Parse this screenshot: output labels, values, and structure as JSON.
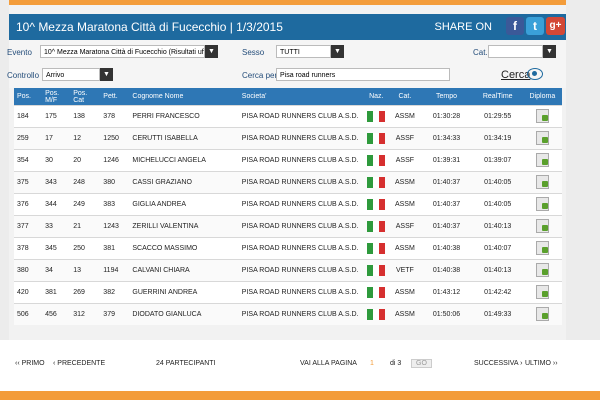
{
  "header": {
    "title": "10^ Mezza Maratona Città di Fucecchio  |  1/3/2015",
    "share_label": "SHARE ON",
    "social": [
      "f",
      "t",
      "g+"
    ]
  },
  "filters": {
    "evento_label": "Evento",
    "evento_value": "10^ Mezza Maratona Città di Fucecchio (Risultati ufficiali)",
    "sesso_label": "Sesso",
    "sesso_value": "TUTTI",
    "cat_label": "Cat.",
    "cat_value": "",
    "controllo_label": "Controllo",
    "controllo_value": "Arrivo",
    "cerca_per_label": "Cerca per",
    "cerca_per_value": "Pisa road runners",
    "cerca_button": "Cerca"
  },
  "table": {
    "headers": [
      "Pos.",
      "Pos. M/F",
      "Pos. Cat",
      "Pett.",
      "Cognome Nome",
      "Societa'",
      "Naz.",
      "Cat.",
      "Tempo",
      "RealTime",
      "Diploma"
    ],
    "rows": [
      [
        "184",
        "175",
        "138",
        "378",
        "PERRI FRANCESCO",
        "PISA ROAD RUNNERS CLUB A.S.D.",
        "ASSM",
        "01:30:28",
        "01:29:55"
      ],
      [
        "259",
        "17",
        "12",
        "1250",
        "CERUTTI ISABELLA",
        "PISA ROAD RUNNERS CLUB A.S.D.",
        "ASSF",
        "01:34:33",
        "01:34:19"
      ],
      [
        "354",
        "30",
        "20",
        "1246",
        "MICHELUCCI ANGELA",
        "PISA ROAD RUNNERS CLUB A.S.D.",
        "ASSF",
        "01:39:31",
        "01:39:07"
      ],
      [
        "375",
        "343",
        "248",
        "380",
        "CASSI GRAZIANO",
        "PISA ROAD RUNNERS CLUB A.S.D.",
        "ASSM",
        "01:40:37",
        "01:40:05"
      ],
      [
        "376",
        "344",
        "249",
        "383",
        "GIGLIA ANDREA",
        "PISA ROAD RUNNERS CLUB A.S.D.",
        "ASSM",
        "01:40:37",
        "01:40:05"
      ],
      [
        "377",
        "33",
        "21",
        "1243",
        "ZERILLI VALENTINA",
        "PISA ROAD RUNNERS CLUB A.S.D.",
        "ASSF",
        "01:40:37",
        "01:40:13"
      ],
      [
        "378",
        "345",
        "250",
        "381",
        "SCACCO MASSIMO",
        "PISA ROAD RUNNERS CLUB A.S.D.",
        "ASSM",
        "01:40:38",
        "01:40:07"
      ],
      [
        "380",
        "34",
        "13",
        "1194",
        "CALVANI CHIARA",
        "PISA ROAD RUNNERS CLUB A.S.D.",
        "VETF",
        "01:40:38",
        "01:40:13"
      ],
      [
        "420",
        "381",
        "269",
        "382",
        "GUERRINI ANDREA",
        "PISA ROAD RUNNERS CLUB A.S.D.",
        "ASSM",
        "01:43:12",
        "01:42:42"
      ],
      [
        "506",
        "456",
        "312",
        "379",
        "DIODATO GIANLUCA",
        "PISA ROAD RUNNERS CLUB A.S.D.",
        "ASSM",
        "01:50:06",
        "01:49:33"
      ]
    ]
  },
  "pager": {
    "first": "‹‹ PRIMO",
    "prev": "‹ PRECEDENTE",
    "count": "24 PARTECIPANTI",
    "goto_label": "VAI ALLA PAGINA",
    "page": "1",
    "of": "di 3",
    "go": "GO",
    "next": "SUCCESSIVA ›",
    "last": "ULTIMO ››"
  },
  "colors": {
    "header": "#1e6a9f",
    "table_header": "#2e77b5",
    "accent": "#f39c3a",
    "flag": [
      "#2e9a3c",
      "#ffffff",
      "#d62f2f"
    ]
  }
}
